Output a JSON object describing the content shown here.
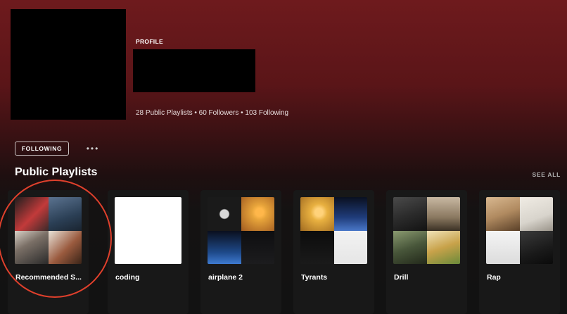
{
  "header": {
    "type_label": "PROFILE",
    "stats": "28 Public Playlists • 60 Followers • 103 Following"
  },
  "actions": {
    "follow_label": "FOLLOWING",
    "more_label": "•••"
  },
  "section": {
    "title": "Public Playlists",
    "see_all_label": "SEE ALL"
  },
  "playlists": [
    {
      "title": "Recommended S...",
      "cover_colors": [
        "#c23a3a",
        "#2b3f55",
        "#e6e0d8",
        "#6f3b2a"
      ]
    },
    {
      "title": "coding",
      "cover_colors": [
        "#ffffff",
        "#ffffff",
        "#ffffff",
        "#ffffff"
      ]
    },
    {
      "title": "airplane 2",
      "cover_colors": [
        "#1a1a1a",
        "#e6a33a",
        "#1e4a8a",
        "#0e0e10"
      ]
    },
    {
      "title": "Tyrants",
      "cover_colors": [
        "#e8b040",
        "#1f3c7a",
        "#0c0c0c",
        "#f2f2f2"
      ]
    },
    {
      "title": "Drill",
      "cover_colors": [
        "#2c2c2c",
        "#b0a08c",
        "#48563a",
        "#e4d4a8"
      ]
    },
    {
      "title": "Rap",
      "cover_colors": [
        "#b08a60",
        "#d8d4cc",
        "#e8e8e8",
        "#1a1a1a"
      ]
    }
  ],
  "annotation": {
    "color": "#e0402c"
  }
}
